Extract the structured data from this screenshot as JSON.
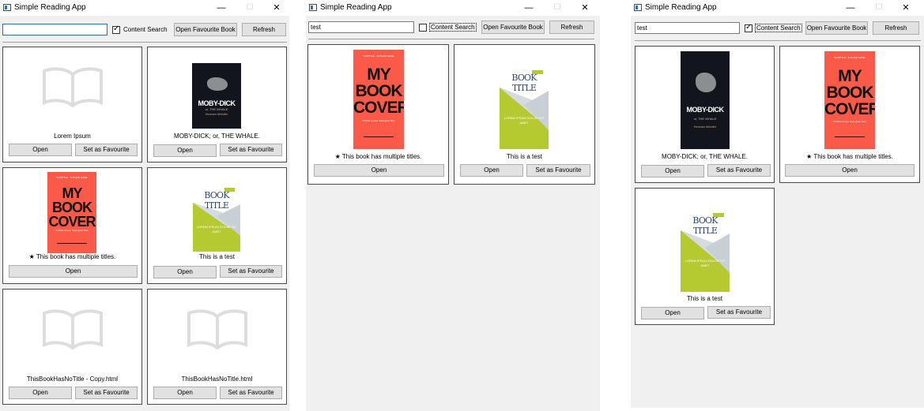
{
  "app": {
    "title": "Simple Reading App"
  },
  "controls": {
    "minimize": "—",
    "maximize": "☐",
    "close": "✕"
  },
  "toolbar": {
    "content_search_label": "Content Search",
    "open_favourite_label": "Open Favourite Book",
    "refresh_label": "Refresh"
  },
  "labels": {
    "open": "Open",
    "set_favourite": "Set as Favourite"
  },
  "panels": [
    {
      "search_value": "",
      "content_search_checked": true,
      "books": [
        {
          "title": "Lorem Ipsum",
          "cover": "placeholder",
          "favourite_button": true
        },
        {
          "title": "MOBY-DICK; or, THE WHALE.",
          "cover": "moby-dick",
          "favourite_button": true
        },
        {
          "title": "★ This book has multiple titles.",
          "cover": "my-book-cover",
          "favourite_button": false
        },
        {
          "title": "This is a test",
          "cover": "book-title",
          "favourite_button": true
        },
        {
          "title": "ThisBookHasNoTitle - Copy.html",
          "cover": "placeholder",
          "favourite_button": true
        },
        {
          "title": "ThisBookHasNoTitle.html",
          "cover": "placeholder",
          "favourite_button": true
        }
      ]
    },
    {
      "search_value": "test",
      "content_search_checked": false,
      "books": [
        {
          "title": "★ This book has multiple titles.",
          "cover": "my-book-cover",
          "favourite_button": false
        },
        {
          "title": "This is a test",
          "cover": "book-title",
          "favourite_button": true
        }
      ]
    },
    {
      "search_value": "test",
      "content_search_checked": true,
      "books": [
        {
          "title": "MOBY-DICK; or, THE WHALE.",
          "cover": "moby-dick",
          "favourite_button": true
        },
        {
          "title": "★ This book has multiple titles.",
          "cover": "my-book-cover",
          "favourite_button": false
        },
        {
          "title": "This is a test",
          "cover": "book-title",
          "favourite_button": true
        }
      ]
    }
  ],
  "cover_text": {
    "moby_title": "MOBY-DICK",
    "moby_sub": "or, THE WHALE",
    "moby_author": "Herman Melville",
    "red_header": "SUBTITLE · AUTHOR NAME",
    "red_title": "MY BOOK COVER",
    "red_sub": "Subtitle of your book goes here",
    "green_tag": "SUBTITLE",
    "green_title": "BOOK TITLE",
    "green_sub": "SUBTITLE HERE",
    "green_lorem": "LOREM IPSUM DOLOR SIT AMET"
  },
  "colors": {
    "accent_focus": "#0078d7",
    "card_border": "#4a4a4a",
    "button_bg": "#e1e1e1",
    "window_bg": "#f0f0f0"
  }
}
